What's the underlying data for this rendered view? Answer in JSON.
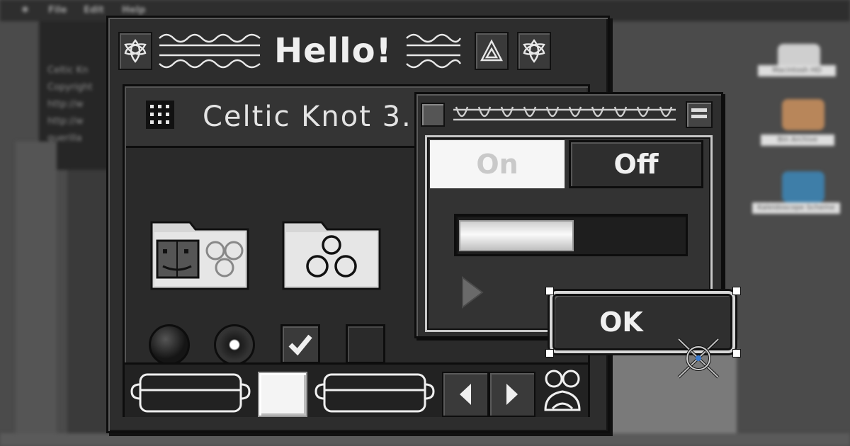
{
  "desktop": {
    "menu": [
      "File",
      "Edit",
      "Help"
    ],
    "text_window_lines": [
      "Celtic Kn",
      "Copyright",
      "http://w",
      "http://w",
      "guerilla"
    ],
    "desktop_icons": [
      {
        "label": "Macintosh HD"
      },
      {
        "label": "Bin Archive"
      },
      {
        "label": "Kaleidoscope Scheme"
      }
    ]
  },
  "main_window": {
    "title": "Hello!",
    "inner_title": "Celtic Knot 3.",
    "folders": [
      "finder-folder",
      "trefoil-folder"
    ],
    "controls": {
      "radio_1_selected": false,
      "radio_2_selected": true,
      "checkbox_1_checked": true,
      "checkbox_2_checked": false
    },
    "icons": {
      "grid": "grid-icon",
      "left_arrow": "left-arrow-icon",
      "right_arrow": "right-arrow-icon",
      "knot": "celtic-knot-icon"
    }
  },
  "settings_panel": {
    "on_label": "On",
    "off_label": "Off",
    "selected": "On",
    "slider_fraction": 0.5
  },
  "ok_button": {
    "label": "OK"
  },
  "colors": {
    "window_bg": "#2d2d2d",
    "border": "#0d0d0d",
    "light": "#efefef"
  }
}
